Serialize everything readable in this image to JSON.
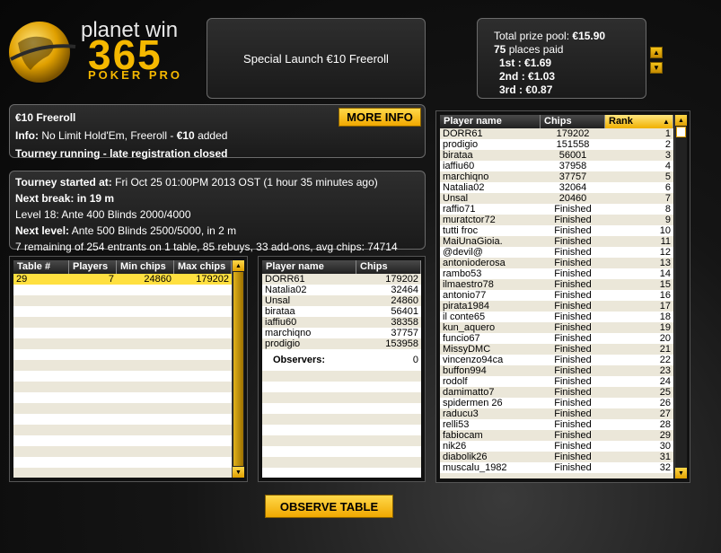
{
  "brand": {
    "line1": "planet win",
    "line2": "365",
    "line3": "POKER PRO"
  },
  "colors": {
    "accent": "#f5b800",
    "selected_row": "#ffe040"
  },
  "tournament_title": "Special Launch €10 Freeroll",
  "prize": {
    "total_label": "Total prize pool:",
    "total_value": "€15.90",
    "places_count": "75",
    "places_label": "places paid",
    "p1_label": "1st",
    "p1_value": ": €1.69",
    "p2_label": "2nd",
    "p2_value": ": €1.03",
    "p3_label": "3rd",
    "p3_value": ": €0.87"
  },
  "info": {
    "name": "€10 Freeroll",
    "info_label": "Info:",
    "info_text": "No Limit Hold'Em, Freeroll -",
    "info_amount": "€10",
    "info_suffix": "added",
    "status": "Tourney running - late registration closed",
    "more_button": "MORE INFO"
  },
  "status": {
    "started_label": "Tourney started at:",
    "started_value": "Fri Oct 25 01:00PM 2013 OST (1 hour 35 minutes ago)",
    "next_break": "Next break: in 19 m",
    "level": "Level 18: Ante 400 Blinds 2000/4000",
    "next_level_label": "Next level:",
    "next_level_value": "Ante 500 Blinds 2500/5000, in 2 m",
    "summary": "7 remaining of 254 entrants on 1 table, 85 rebuys, 33 add-ons, avg chips: 74714"
  },
  "tables": {
    "headers": [
      "Table #",
      "Players",
      "Min chips",
      "Max chips"
    ],
    "rows": [
      [
        "29",
        "7",
        "24860",
        "179202"
      ]
    ]
  },
  "table_players": {
    "headers": [
      "Player name",
      "Chips"
    ],
    "rows": [
      [
        "DORR61",
        "179202"
      ],
      [
        "Natalia02",
        "32464"
      ],
      [
        "Unsal",
        "24860"
      ],
      [
        "birataa",
        "56401"
      ],
      [
        "iaffiu60",
        "38358"
      ],
      [
        "marchiqno",
        "37757"
      ],
      [
        "prodigio",
        "153958"
      ]
    ],
    "observers_label": "Observers:",
    "observers_count": "0"
  },
  "players": {
    "headers": [
      "Player name",
      "Chips",
      "Rank"
    ],
    "rows": [
      [
        "DORR61",
        "179202",
        "1"
      ],
      [
        "prodigio",
        "151558",
        "2"
      ],
      [
        "birataa",
        "56001",
        "3"
      ],
      [
        "iaffiu60",
        "37958",
        "4"
      ],
      [
        "marchiqno",
        "37757",
        "5"
      ],
      [
        "Natalia02",
        "32064",
        "6"
      ],
      [
        "Unsal",
        "20460",
        "7"
      ],
      [
        "raffio71",
        "Finished",
        "8"
      ],
      [
        "muratctor72",
        "Finished",
        "9"
      ],
      [
        "tutti froc",
        "Finished",
        "10"
      ],
      [
        "MaiUnaGioia.",
        "Finished",
        "11"
      ],
      [
        "@devil@",
        "Finished",
        "12"
      ],
      [
        "antonioderosa",
        "Finished",
        "13"
      ],
      [
        "rambo53",
        "Finished",
        "14"
      ],
      [
        "ilmaestro78",
        "Finished",
        "15"
      ],
      [
        "antonio77",
        "Finished",
        "16"
      ],
      [
        "pirata1984",
        "Finished",
        "17"
      ],
      [
        "il conte65",
        "Finished",
        "18"
      ],
      [
        "kun_aquero",
        "Finished",
        "19"
      ],
      [
        "funcio67",
        "Finished",
        "20"
      ],
      [
        "MissyDMC",
        "Finished",
        "21"
      ],
      [
        "vincenzo94ca",
        "Finished",
        "22"
      ],
      [
        "buffon994",
        "Finished",
        "23"
      ],
      [
        "rodolf",
        "Finished",
        "24"
      ],
      [
        "damimatto7",
        "Finished",
        "25"
      ],
      [
        "spidermen 26",
        "Finished",
        "26"
      ],
      [
        "raducu3",
        "Finished",
        "27"
      ],
      [
        "relli53",
        "Finished",
        "28"
      ],
      [
        "fabiocam",
        "Finished",
        "29"
      ],
      [
        "nik26",
        "Finished",
        "30"
      ],
      [
        "diabolik26",
        "Finished",
        "31"
      ],
      [
        "muscalu_1982",
        "Finished",
        "32"
      ]
    ]
  },
  "observe_button": "OBSERVE TABLE"
}
